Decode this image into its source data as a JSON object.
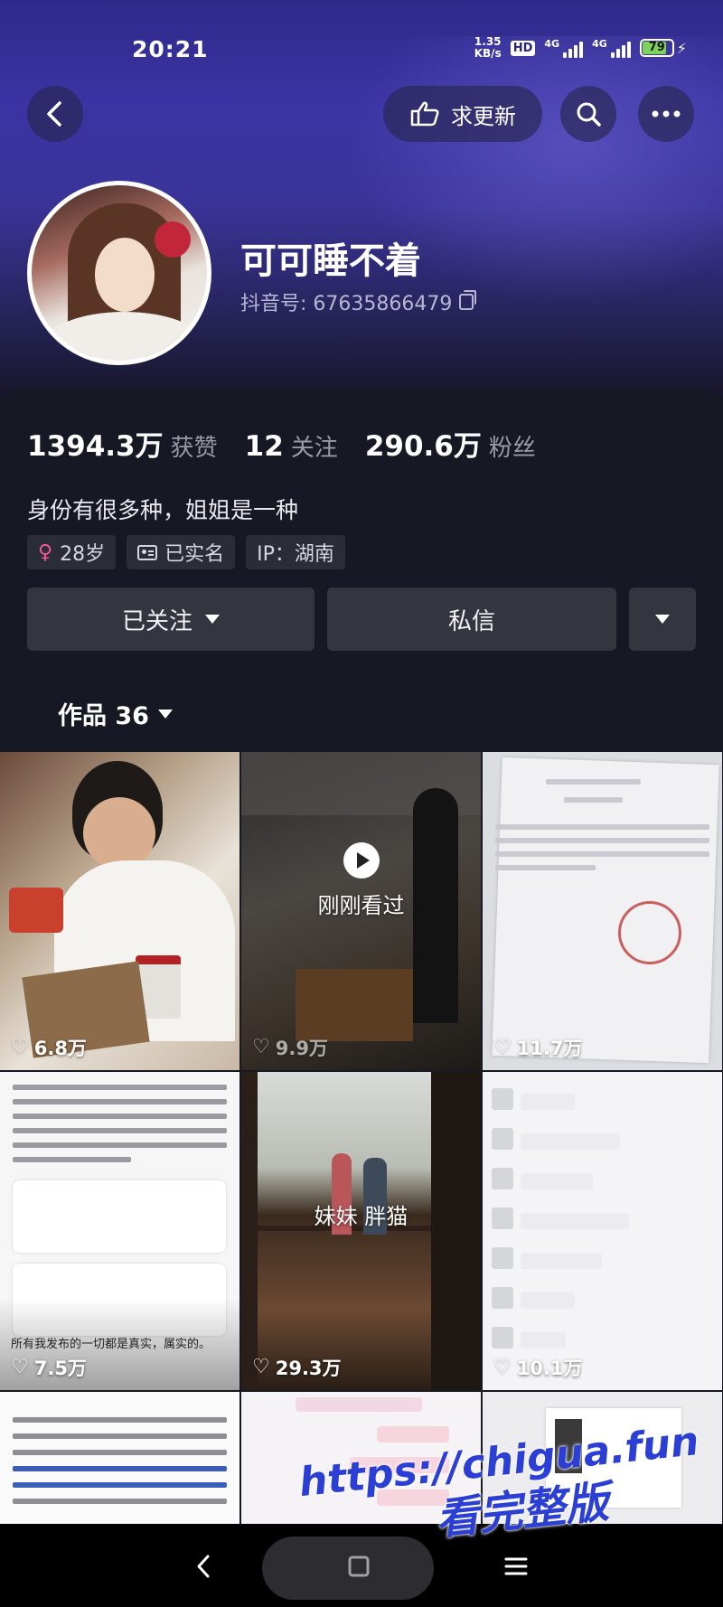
{
  "status_bar": {
    "time": "20:21",
    "net_speed_value": "1.35",
    "net_speed_unit": "KB/s",
    "hd_label": "HD",
    "signal1_label": "4G",
    "signal2_label": "4G",
    "battery": "79"
  },
  "top_nav": {
    "request_update_label": "求更新"
  },
  "profile": {
    "nickname": "可可睡不着",
    "douyin_id": "抖音号: 67635866479",
    "stats": {
      "likes_value": "1394.3万",
      "likes_label": "获赞",
      "following_value": "12",
      "following_label": "关注",
      "followers_value": "290.6万",
      "followers_label": "粉丝"
    },
    "bio": "身份有很多种，姐姐是一种",
    "tags": {
      "age": "28岁",
      "verified": "已实名",
      "ip": "IP：湖南"
    }
  },
  "actions": {
    "followed_label": "已关注",
    "message_label": "私信"
  },
  "works_tab": {
    "label": "作品 36"
  },
  "videos": [
    {
      "likes": "6.8万"
    },
    {
      "likes": "9.9万",
      "overlay": "刚刚看过"
    },
    {
      "likes": "11.7万"
    },
    {
      "likes": "7.5万",
      "caption_bottom": "所有我发布的一切都是真实，属实的。"
    },
    {
      "likes": "29.3万",
      "overlay": "妹妹 胖猫"
    },
    {
      "likes": "10.1万"
    }
  ],
  "watermark": {
    "line1": "https://chigua.fun",
    "line2": "看完整版"
  },
  "colors": {
    "hero_top": "#2f2a8a",
    "background": "#161823",
    "button": "#34363f",
    "female_icon": "#f5569a",
    "battery_fill": "#7dd45a",
    "watermark": "#2c3fd4"
  }
}
